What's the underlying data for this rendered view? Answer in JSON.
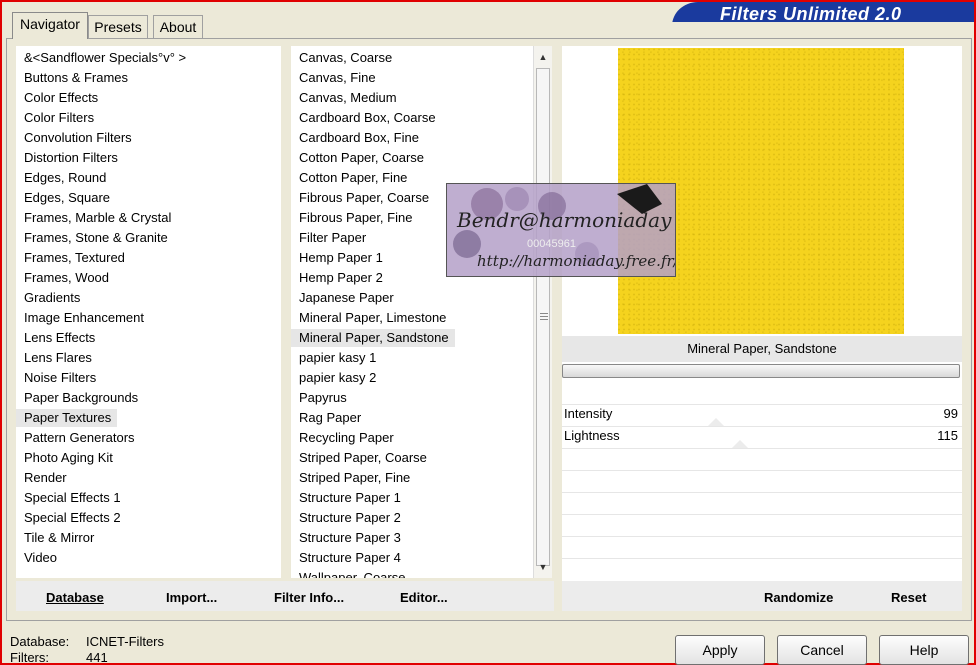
{
  "app": {
    "title": "Filters Unlimited 2.0"
  },
  "tabs": [
    {
      "label": "Navigator"
    },
    {
      "label": "Presets"
    },
    {
      "label": "About"
    }
  ],
  "categories": [
    "&<Sandflower Specials°v° >",
    "Buttons & Frames",
    "Color Effects",
    "Color Filters",
    "Convolution Filters",
    "Distortion Filters",
    "Edges, Round",
    "Edges, Square",
    "Frames, Marble & Crystal",
    "Frames, Stone & Granite",
    "Frames, Textured",
    "Frames, Wood",
    "Gradients",
    "Image Enhancement",
    "Lens Effects",
    "Lens Flares",
    "Noise Filters",
    "Paper Backgrounds",
    "Paper Textures",
    "Pattern Generators",
    "Photo Aging Kit",
    "Render",
    "Special Effects 1",
    "Special Effects 2",
    "Tile & Mirror",
    "Video"
  ],
  "selected_category": "Paper Textures",
  "filters": [
    "Canvas, Coarse",
    "Canvas, Fine",
    "Canvas, Medium",
    "Cardboard Box, Coarse",
    "Cardboard Box, Fine",
    "Cotton Paper, Coarse",
    "Cotton Paper, Fine",
    "Fibrous Paper, Coarse",
    "Fibrous Paper, Fine",
    "Filter Paper",
    "Hemp Paper 1",
    "Hemp Paper 2",
    "Japanese Paper",
    "Mineral Paper, Limestone",
    "Mineral Paper, Sandstone",
    "papier kasy 1",
    "papier kasy 2",
    "Papyrus",
    "Rag Paper",
    "Recycling Paper",
    "Striped Paper, Coarse",
    "Striped Paper, Fine",
    "Structure Paper 1",
    "Structure Paper 2",
    "Structure Paper 3",
    "Structure Paper 4",
    "Wallpaper, Coarse"
  ],
  "selected_filter": "Mineral Paper, Sandstone",
  "left_buttons": {
    "database": "Database",
    "import": "Import...",
    "filter_info": "Filter Info...",
    "editor": "Editor..."
  },
  "preview": {
    "color": "#f5d31e",
    "filter_name": "Mineral Paper, Sandstone"
  },
  "sliders": [
    {
      "label": "Intensity",
      "value": "99"
    },
    {
      "label": "Lightness",
      "value": "115"
    }
  ],
  "right_buttons": {
    "randomize": "Randomize",
    "reset": "Reset"
  },
  "status": {
    "database_label": "Database:",
    "database_value": "ICNET-Filters",
    "filters_label": "Filters:",
    "filters_value": "441"
  },
  "dialog_buttons": {
    "apply": "Apply",
    "cancel": "Cancel",
    "help": "Help"
  },
  "watermark": {
    "name": "Bendr@harmoniaday",
    "number": "00045961",
    "url": "http://harmoniaday.free.fr/"
  },
  "colors": {
    "frame": "#e00000",
    "title_bg": "#1a3a9e",
    "window_bg": "#ece9d8"
  }
}
